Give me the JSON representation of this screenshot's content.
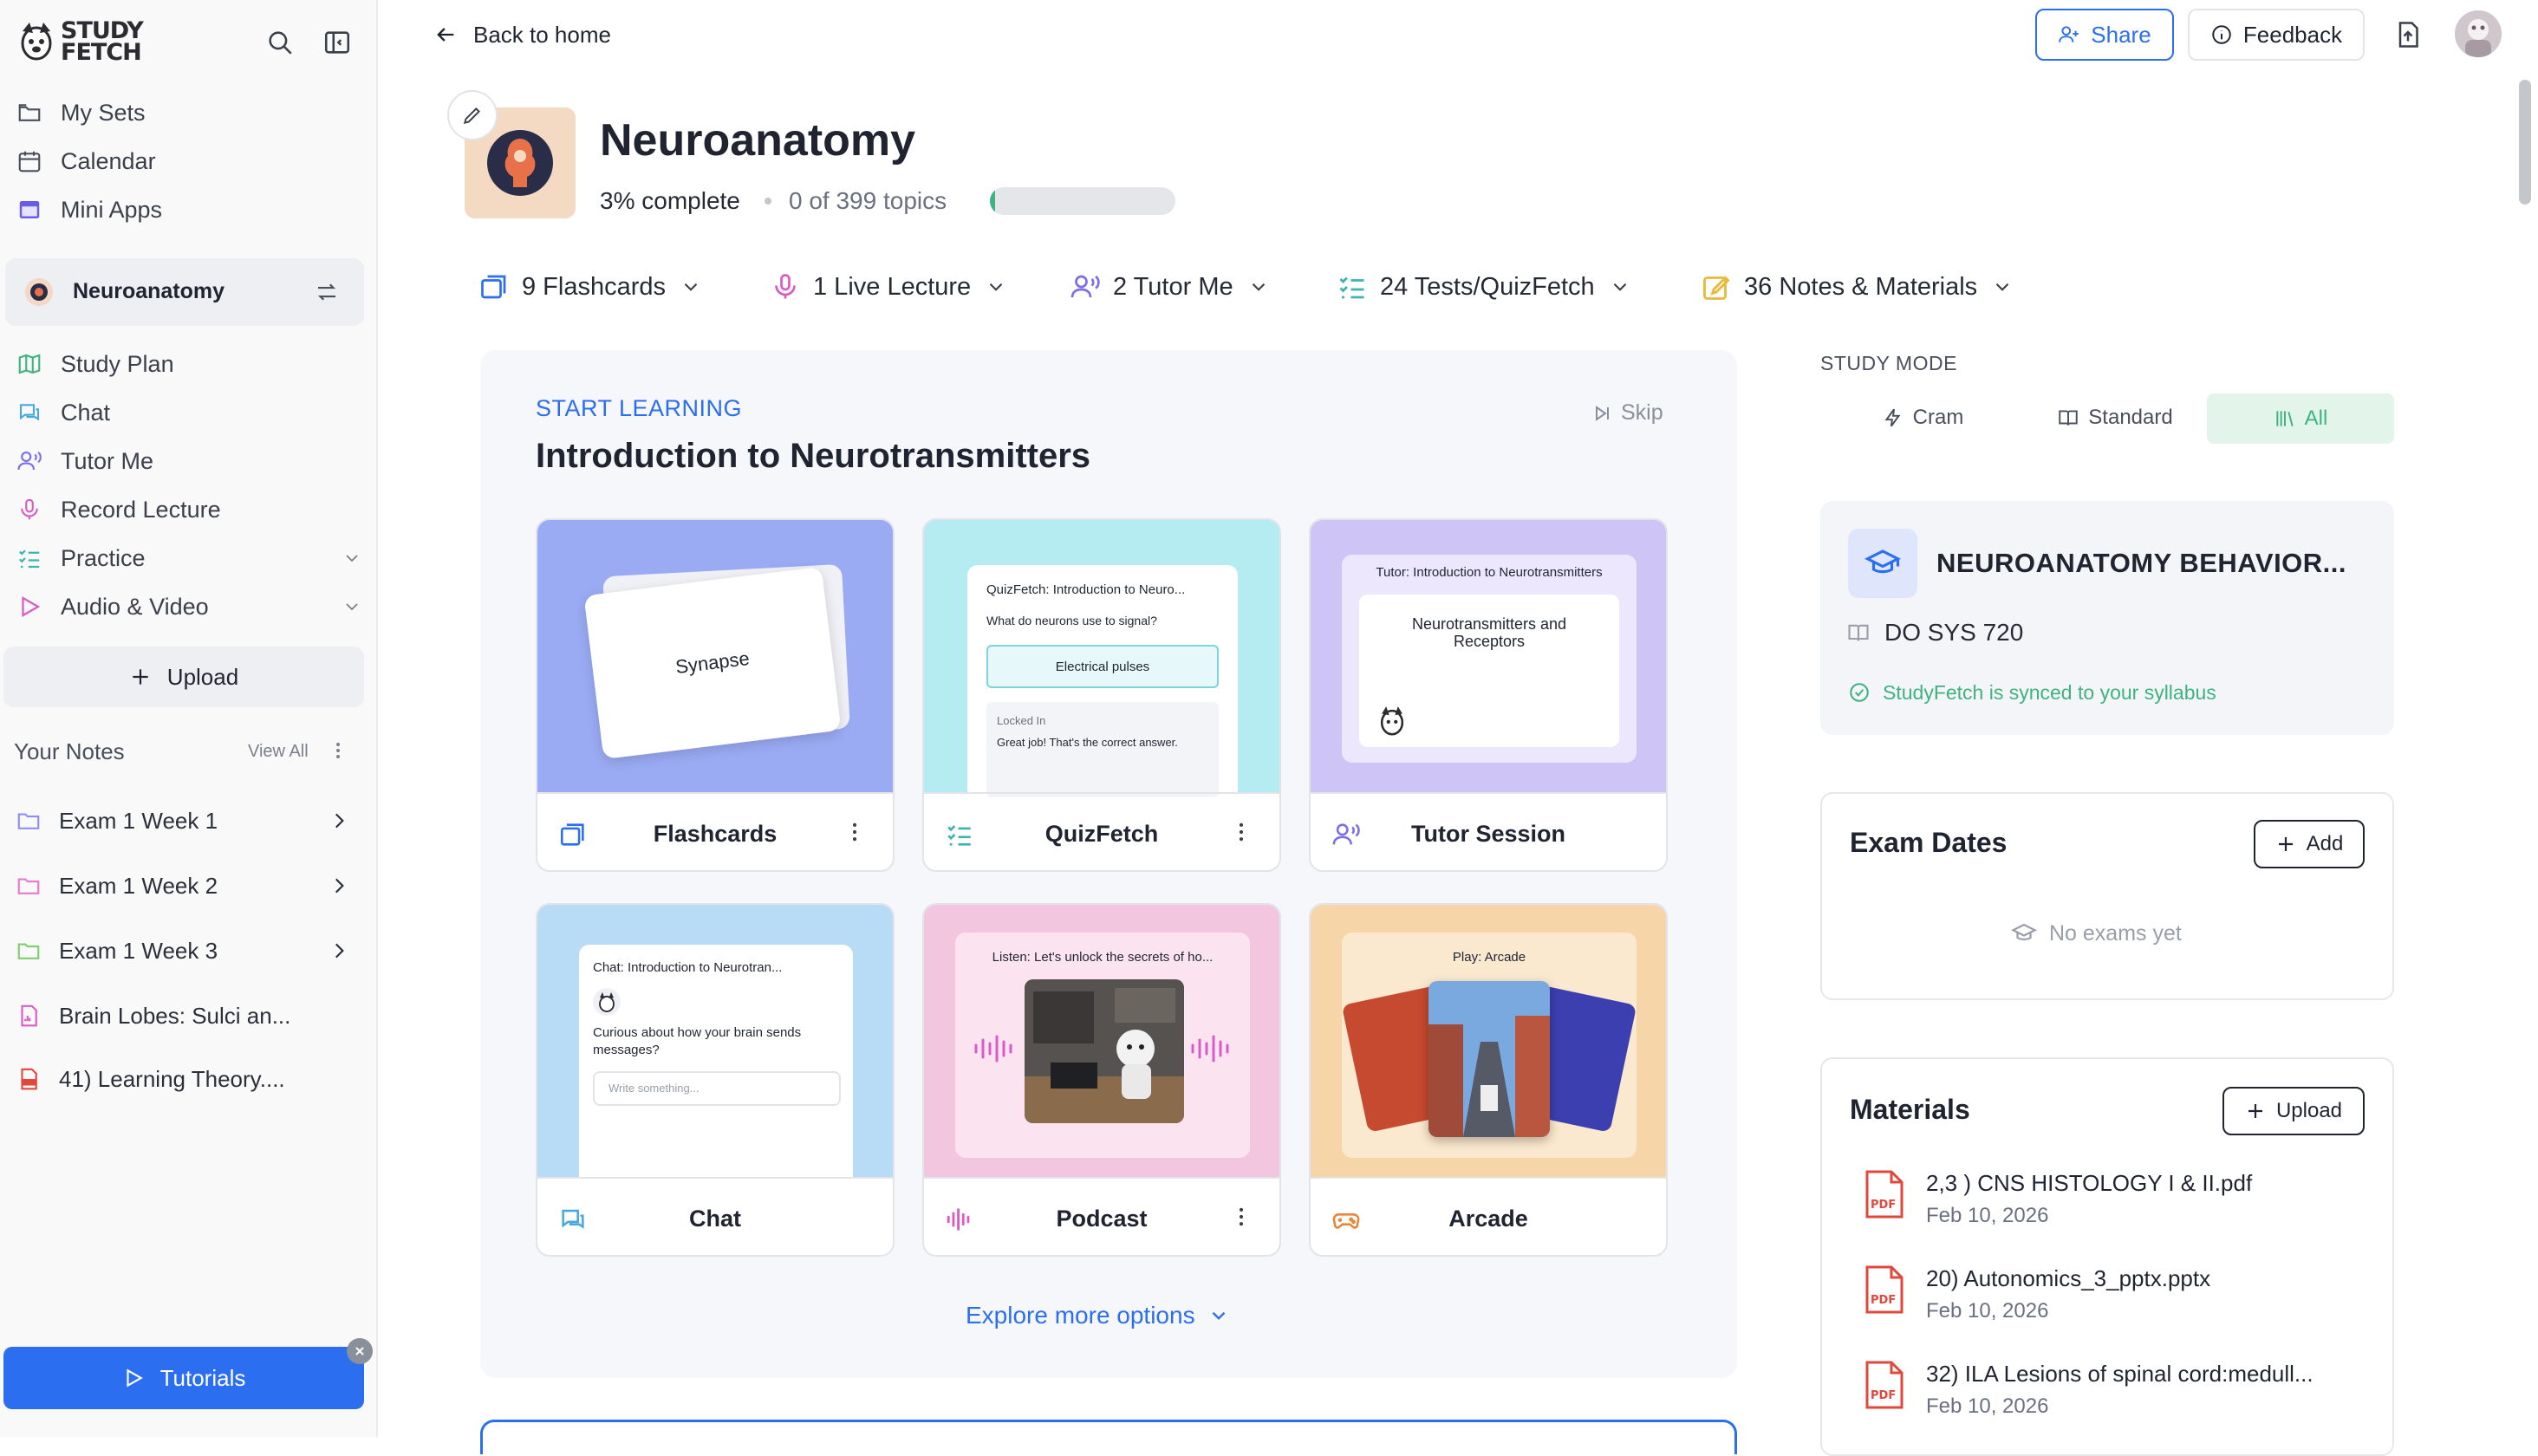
{
  "logo": {
    "line1": "STUDY",
    "line2": "FETCH"
  },
  "sidebar": {
    "nav": [
      {
        "label": "My Sets",
        "icon": "folder-icon"
      },
      {
        "label": "Calendar",
        "icon": "calendar-icon"
      },
      {
        "label": "Mini Apps",
        "icon": "app-window-icon"
      }
    ],
    "current_set": "Neuroanatomy",
    "set_nav": [
      {
        "label": "Study Plan",
        "icon": "map-icon"
      },
      {
        "label": "Chat",
        "icon": "chat-icon"
      },
      {
        "label": "Tutor Me",
        "icon": "tutor-icon"
      },
      {
        "label": "Record Lecture",
        "icon": "microphone-icon"
      },
      {
        "label": "Practice",
        "icon": "checklist-icon"
      },
      {
        "label": "Audio & Video",
        "icon": "play-icon"
      }
    ],
    "upload_label": "Upload",
    "notes_header": "Your Notes",
    "view_all": "View All",
    "notes": [
      {
        "label": "Exam 1 Week 1",
        "icon": "folder-icon",
        "color": "#8e8ef0"
      },
      {
        "label": "Exam 1 Week 2",
        "icon": "folder-icon",
        "color": "#e879c9"
      },
      {
        "label": "Exam 1 Week 3",
        "icon": "folder-icon",
        "color": "#7ccf6a"
      },
      {
        "label": "Brain Lobes: Sulci an...",
        "icon": "audio-file-icon",
        "color": "#d85bc6"
      },
      {
        "label": "41) Learning Theory....",
        "icon": "pdf-file-icon",
        "color": "#e0483c"
      }
    ],
    "tutorials_label": "Tutorials"
  },
  "header": {
    "back_label": "Back to home",
    "share_label": "Share",
    "feedback_label": "Feedback"
  },
  "set": {
    "title": "Neuroanatomy",
    "complete": "3% complete",
    "topics": "0 of 399 topics",
    "progress": 0.03
  },
  "tabs": [
    {
      "label": "9 Flashcards",
      "icon": "flashcards-icon"
    },
    {
      "label": "1 Live Lecture",
      "icon": "microphone-icon"
    },
    {
      "label": "2 Tutor Me",
      "icon": "tutor-icon"
    },
    {
      "label": "24 Tests/QuizFetch",
      "icon": "checklist-icon"
    },
    {
      "label": "36 Notes & Materials",
      "icon": "notes-icon"
    }
  ],
  "learning": {
    "eyebrow": "START LEARNING",
    "title": "Introduction to Neurotransmitters",
    "skip": "Skip",
    "cards": [
      {
        "label": "Flashcards",
        "preview_text": "Synapse"
      },
      {
        "label": "QuizFetch",
        "preview_title": "QuizFetch: Introduction to Neuro...",
        "question": "What do neurons use to signal?",
        "answer": "Electrical pulses",
        "locked": "Locked In",
        "feedback": "Great job! That's the correct answer."
      },
      {
        "label": "Tutor Session",
        "preview_title": "Tutor: Introduction to Neurotransmitters",
        "topic": "Neurotransmitters and Receptors"
      },
      {
        "label": "Chat",
        "preview_title": "Chat: Introduction to Neurotran...",
        "message": "Curious about how your brain sends messages?",
        "placeholder": "Write something..."
      },
      {
        "label": "Podcast",
        "preview_title": "Listen: Let's unlock the secrets of ho..."
      },
      {
        "label": "Arcade",
        "preview_title": "Play: Arcade"
      }
    ],
    "explore": "Explore more options"
  },
  "study_mode": {
    "label": "STUDY MODE",
    "options": [
      "Cram",
      "Standard",
      "All"
    ],
    "selected": "All"
  },
  "course": {
    "name": "NEUROANATOMY BEHAVIOR...",
    "code": "DO SYS 720",
    "synced": "StudyFetch is synced to your syllabus"
  },
  "exams": {
    "title": "Exam Dates",
    "add_label": "Add",
    "empty": "No exams yet"
  },
  "materials": {
    "title": "Materials",
    "upload_label": "Upload",
    "items": [
      {
        "name": "2,3 ) CNS HISTOLOGY I & II.pdf",
        "date": "Feb 10, 2026"
      },
      {
        "name": "20) Autonomics_3_pptx.pptx",
        "date": "Feb 10, 2026"
      },
      {
        "name": "32) ILA Lesions of spinal cord:medull...",
        "date": "Feb 10, 2026"
      }
    ]
  },
  "colors": {
    "accent": "#2c6ef0",
    "green": "#3fb37f",
    "text": "#1f2430"
  }
}
